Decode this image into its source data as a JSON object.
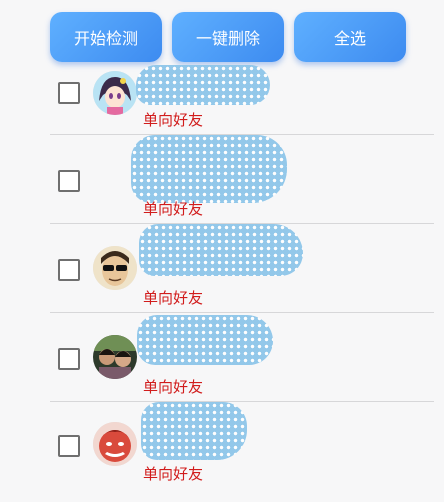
{
  "toolbar": {
    "start_detect_label": "开始检测",
    "delete_all_label": "一键删除",
    "select_all_label": "全选"
  },
  "friends": [
    {
      "status": "单向好友",
      "checked": false,
      "avatar": "anime-girl-avatar"
    },
    {
      "status": "单向好友",
      "checked": false,
      "avatar": "none"
    },
    {
      "status": "单向好友",
      "checked": false,
      "avatar": "sunglasses-man-avatar"
    },
    {
      "status": "单向好友",
      "checked": false,
      "avatar": "couple-photo-avatar"
    },
    {
      "status": "单向好友",
      "checked": false,
      "avatar": "red-cartoon-face-avatar"
    }
  ],
  "colors": {
    "button_gradient_start": "#5fb0ff",
    "button_gradient_end": "#3d8bf0",
    "status_text": "#d11c1c",
    "redaction_blob": "#8ec6ea"
  }
}
